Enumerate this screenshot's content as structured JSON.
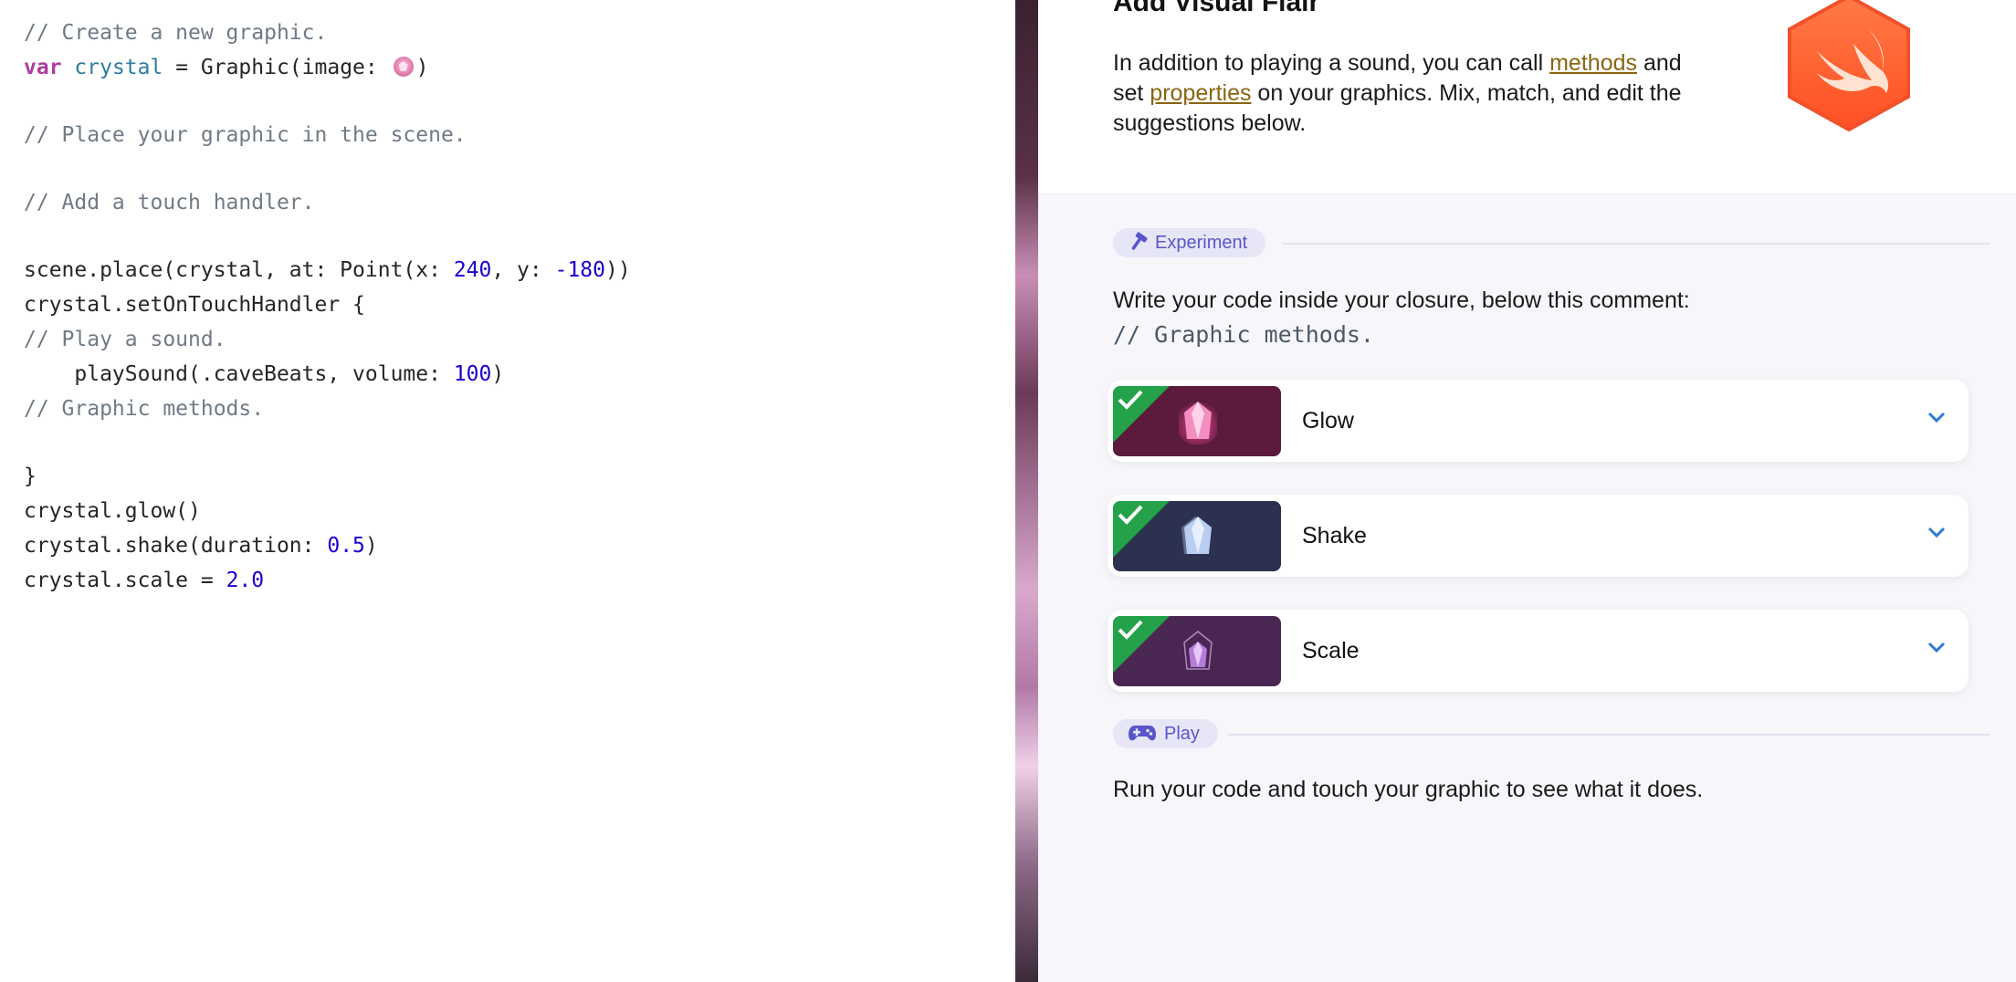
{
  "editor": {
    "lines": {
      "l1": "// Create a new graphic.",
      "l2_kw": "var",
      "l2_ident": "crystal",
      "l2_pre": " = Graphic(image: ",
      "l2_post": ")",
      "l3": "// Place your graphic in the scene.",
      "l4": "// Add a touch handler.",
      "l5_a": "scene.place(crystal, at: Point(x: ",
      "l5_x": "240",
      "l5_b": ", y: ",
      "l5_y": "-180",
      "l5_c": "))",
      "l6": "crystal.setOnTouchHandler {",
      "l7": "// Play a sound.",
      "l8_a": "    playSound(.caveBeats, volume: ",
      "l8_v": "100",
      "l8_b": ")",
      "l9": "// Graphic methods.",
      "l10": "}",
      "l11": "crystal.glow()",
      "l12_a": "crystal.shake(duration: ",
      "l12_v": "0.5",
      "l12_b": ")",
      "l13_a": "crystal.scale = ",
      "l13_v": "2.0"
    },
    "image_literal_icon": "crystal-image-literal-icon"
  },
  "guide": {
    "title": "Add Visual Flair",
    "intro_a": "In addition to playing a sound, you can call ",
    "intro_link1": "methods",
    "intro_b": " and set ",
    "intro_link2": "properties",
    "intro_c": " on your graphics. Mix, match, and edit the suggestions below.",
    "badge_icon": "swift-badge-icon",
    "experiment_label": "Experiment",
    "instruction": "Write your code inside your closure, below this comment:",
    "instruction_code": "// Graphic methods.",
    "cards": [
      {
        "label": "Glow",
        "bg": "#5c1a3c",
        "gem": "#f06aa6",
        "done": true
      },
      {
        "label": "Shake",
        "bg": "#2c3150",
        "gem": "#9db8e6",
        "done": true
      },
      {
        "label": "Scale",
        "bg": "#4a2752",
        "gem": "#b57bd9",
        "done": true
      }
    ],
    "play_label": "Play",
    "play_text": "Run your code and touch your graphic to see what it does."
  },
  "colors": {
    "accent": "#5a55c9",
    "check": "#23a24a",
    "link": "#8a6512",
    "swift_orange": "#ff5a2c"
  }
}
